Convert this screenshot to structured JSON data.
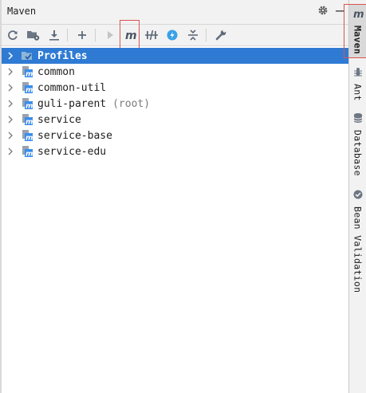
{
  "panel": {
    "title": "Maven"
  },
  "toolbar": {
    "buttons": [
      {
        "name": "reload-icon"
      },
      {
        "name": "folder-generate-icon"
      },
      {
        "name": "download-icon"
      },
      {
        "name": "add-icon"
      },
      {
        "name": "run-icon"
      },
      {
        "name": "maven-goal-icon"
      },
      {
        "name": "toggle-offline-icon"
      },
      {
        "name": "skip-tests-icon"
      },
      {
        "name": "collapse-all-icon"
      },
      {
        "name": "settings-wrench-icon"
      }
    ]
  },
  "tree": {
    "items": [
      {
        "label": "Profiles",
        "suffix": "",
        "icon": "profiles-folder-icon",
        "selected": true
      },
      {
        "label": "common",
        "suffix": "",
        "icon": "maven-module-icon",
        "selected": false
      },
      {
        "label": "common-util",
        "suffix": "",
        "icon": "maven-module-icon",
        "selected": false
      },
      {
        "label": "guli-parent",
        "suffix": "(root)",
        "icon": "maven-module-icon",
        "selected": false
      },
      {
        "label": "service",
        "suffix": "",
        "icon": "maven-module-icon",
        "selected": false
      },
      {
        "label": "service-base",
        "suffix": "",
        "icon": "maven-module-icon",
        "selected": false
      },
      {
        "label": "service-edu",
        "suffix": "",
        "icon": "maven-module-icon",
        "selected": false
      }
    ]
  },
  "side_tabs": [
    {
      "label": "Maven",
      "icon": "maven-m-icon",
      "active": true
    },
    {
      "label": "Ant",
      "icon": "ant-icon",
      "active": false
    },
    {
      "label": "Database",
      "icon": "database-icon",
      "active": false
    },
    {
      "label": "Bean Validation",
      "icon": "bean-validation-icon",
      "active": false
    }
  ],
  "colors": {
    "selection": "#2f7bd3",
    "highlight_box": "#d9534f",
    "module_icon_blue": "#3b8eea"
  }
}
